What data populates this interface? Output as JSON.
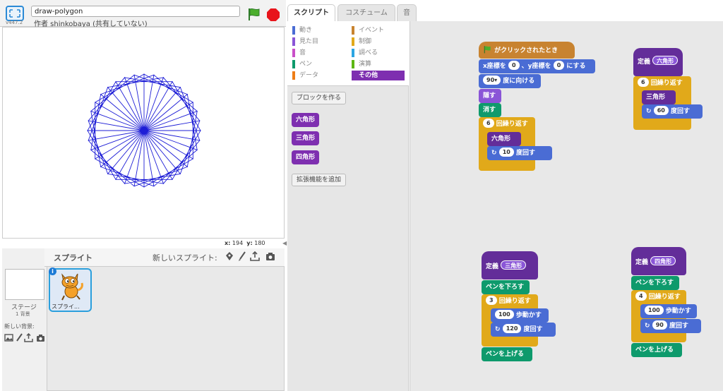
{
  "header": {
    "version": "v447.2",
    "project_title": "draw-polygon",
    "author": "作者 shinkobaya (共有していない)"
  },
  "colors": {
    "pen_line": "#1d1dd6",
    "selected_category": "#7e2fb0",
    "motion": "#4a6cd4",
    "control": "#e1a91a",
    "looks": "#8a55d7",
    "pen": "#0e9a6c",
    "event": "#c88330"
  },
  "stage": {
    "x_label": "x:",
    "x_value": "194",
    "y_label": "y:",
    "y_value": "180"
  },
  "sprites_panel": {
    "title": "スプライト",
    "new_sprite_label": "新しいスプライト:",
    "stage_label": "ステージ",
    "bg_count": "1 背景",
    "new_bg_label": "新しい背景:",
    "sprite_name": "スプライ..."
  },
  "tabs": [
    {
      "label": "スクリプト"
    },
    {
      "label": "コスチューム"
    },
    {
      "label": "音"
    }
  ],
  "palette": {
    "categories_left": [
      {
        "label": "動き"
      },
      {
        "label": "見た目"
      },
      {
        "label": "音"
      },
      {
        "label": "ペン"
      },
      {
        "label": "データ"
      }
    ],
    "categories_right": [
      {
        "label": "イベント"
      },
      {
        "label": "制御"
      },
      {
        "label": "調べる"
      },
      {
        "label": "演算"
      },
      {
        "label": "その他"
      }
    ],
    "make_block": "ブロックを作る",
    "custom_blocks": [
      "六角形",
      "三角形",
      "四角形"
    ],
    "add_extension": "拡張機能を追加"
  },
  "scripts": {
    "main": {
      "hat": "がクリックされたとき",
      "goto_a": "x座標を",
      "goto_x": "0",
      "goto_b": "、y座標を",
      "goto_y": "0",
      "goto_c": "にする",
      "point_val": "90▾",
      "point_text": "度に向ける",
      "hide": "隠す",
      "clear": "消す",
      "repeat_n": "6",
      "repeat_text": "回繰り返す",
      "call": "六角形",
      "turn_val": "10",
      "turn_text": "度回す"
    },
    "hexagon": {
      "define": "定義",
      "name": "六角形",
      "repeat_n": "6",
      "repeat_text": "回繰り返す",
      "call": "三角形",
      "turn_val": "60",
      "turn_text": "度回す"
    },
    "triangle": {
      "define": "定義",
      "name": "三角形",
      "pen_down": "ペンを下ろす",
      "repeat_n": "3",
      "repeat_text": "回繰り返す",
      "move_val": "100",
      "move_text": "歩動かす",
      "turn_val": "120",
      "turn_text": "度回す",
      "pen_up": "ペンを上げる"
    },
    "square": {
      "define": "定義",
      "name": "四角形",
      "pen_down": "ペンを下ろす",
      "repeat_n": "4",
      "repeat_text": "回繰り返す",
      "move_val": "100",
      "move_text": "歩動かす",
      "turn_val": "90",
      "turn_text": "度回す",
      "pen_up": "ペンを上げる"
    }
  }
}
